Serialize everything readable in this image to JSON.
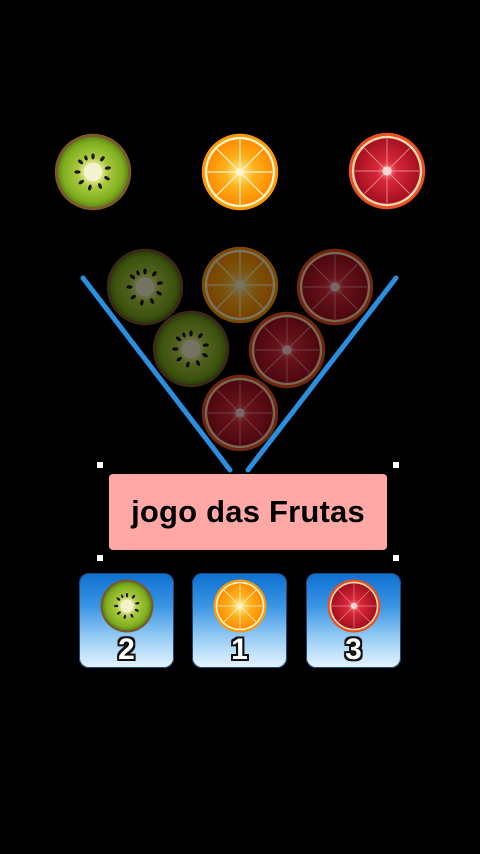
{
  "title_label": "jogo das Frutas",
  "colors": {
    "background": "#000000",
    "funnel": "#2a8fe0",
    "label_bg": "#ffa8a6",
    "card_top": "#0d6fd0",
    "card_bottom": "#e6f5ff"
  },
  "top_fruits": [
    {
      "kind": "kiwi",
      "name": "kiwi-icon"
    },
    {
      "kind": "orange",
      "name": "orange-icon"
    },
    {
      "kind": "blood-orange",
      "name": "blood-orange-icon"
    }
  ],
  "stacked_fruits": [
    {
      "kind": "kiwi"
    },
    {
      "kind": "orange"
    },
    {
      "kind": "blood-orange"
    },
    {
      "kind": "kiwi"
    },
    {
      "kind": "blood-orange"
    },
    {
      "kind": "blood-orange"
    }
  ],
  "answer_cards": [
    {
      "kind": "kiwi",
      "number": "2"
    },
    {
      "kind": "orange",
      "number": "1"
    },
    {
      "kind": "blood-orange",
      "number": "3"
    }
  ]
}
